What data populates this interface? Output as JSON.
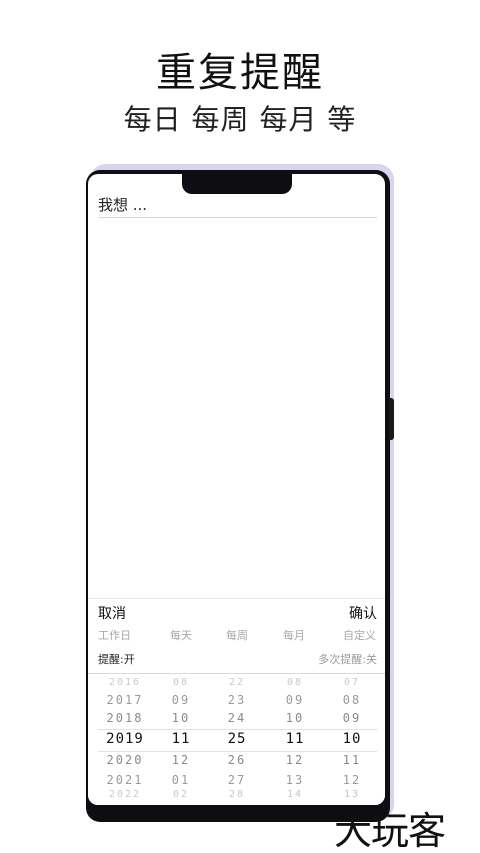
{
  "promo": {
    "title": "重复提醒",
    "subtitle": "每日 每周 每月 等"
  },
  "editor": {
    "placeholder": "我想 ..."
  },
  "picker": {
    "cancel_label": "取消",
    "confirm_label": "确认",
    "quick_options": [
      "工作日",
      "每天",
      "每周",
      "每月",
      "自定义"
    ],
    "reminder_toggle": "提醒:开",
    "multi_reminder_toggle": "多次提醒:关",
    "columns": [
      [
        "2016",
        "2017",
        "2018",
        "2019",
        "2020",
        "2021",
        "2022"
      ],
      [
        "08",
        "09",
        "10",
        "11",
        "12",
        "01",
        "02"
      ],
      [
        "22",
        "23",
        "24",
        "25",
        "26",
        "27",
        "28"
      ],
      [
        "08",
        "09",
        "10",
        "11",
        "12",
        "13",
        "14"
      ],
      [
        "07",
        "08",
        "09",
        "10",
        "11",
        "12",
        "13"
      ]
    ],
    "selected": {
      "year": "2019",
      "month": "11",
      "day": "25",
      "hour": "11",
      "minute": "10"
    }
  },
  "watermark": "大玩客"
}
